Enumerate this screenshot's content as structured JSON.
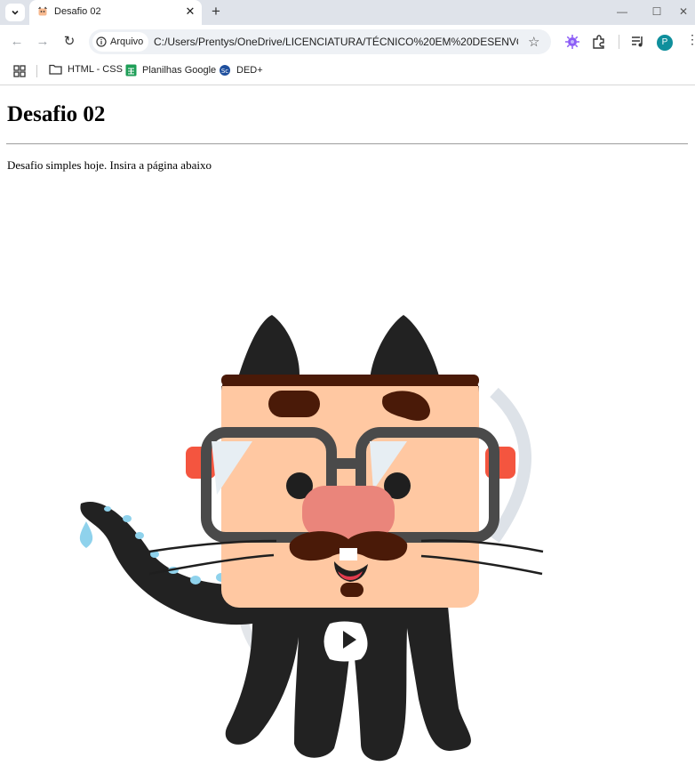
{
  "browser": {
    "tab": {
      "title": "Desafio 02"
    },
    "address_bar": {
      "security_chip": "Arquivo",
      "url": "C:/Users/Prentys/OneDrive/LICENCIATURA/TÉCNICO%20EM%20DESENVOLVI..."
    },
    "profile_initial": "P",
    "bookmarks": [
      {
        "label": "HTML - CSS",
        "icon": "folder-icon"
      },
      {
        "label": "Planilhas Google",
        "icon": "google-sheets-icon"
      },
      {
        "label": "DED+",
        "icon": "ded-logo-icon"
      }
    ]
  },
  "page": {
    "heading": "Desafio 02",
    "intro": "Desafio simples hoje. Insira a página abaixo",
    "image": {
      "subject": "cat-octopus-mascot-with-glasses-and-mustache",
      "accent_colors": [
        "#ffc8a2",
        "#222222",
        "#4a1a08",
        "#ea857b",
        "#f4553f",
        "#8fd2ec"
      ]
    }
  }
}
